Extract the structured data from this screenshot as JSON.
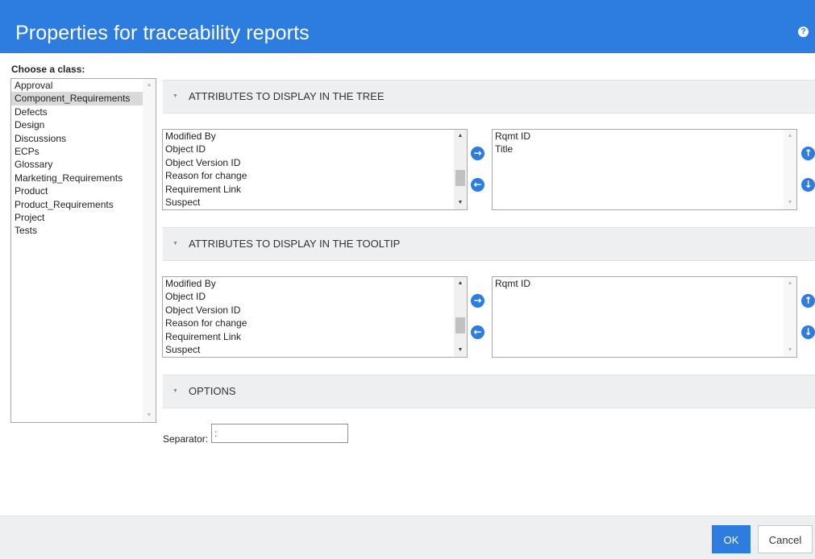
{
  "header": {
    "title": "Properties for traceability reports",
    "help_icon": "?"
  },
  "class_panel": {
    "label": "Choose a class:",
    "items": [
      {
        "label": "Approval",
        "selected": false
      },
      {
        "label": "Component_Requirements",
        "selected": true
      },
      {
        "label": "Defects",
        "selected": false
      },
      {
        "label": "Design",
        "selected": false
      },
      {
        "label": "Discussions",
        "selected": false
      },
      {
        "label": "ECPs",
        "selected": false
      },
      {
        "label": "Glossary",
        "selected": false
      },
      {
        "label": "Marketing_Requirements",
        "selected": false
      },
      {
        "label": "Product",
        "selected": false
      },
      {
        "label": "Product_Requirements",
        "selected": false
      },
      {
        "label": "Project",
        "selected": false
      },
      {
        "label": "Tests",
        "selected": false
      }
    ]
  },
  "tree_section": {
    "title": "ATTRIBUTES TO DISPLAY IN THE TREE",
    "available": [
      "Modified By",
      "Object ID",
      "Object Version ID",
      "Reason for change",
      "Requirement Link",
      "Suspect"
    ],
    "selected": [
      "Rqmt ID",
      "Title"
    ]
  },
  "tooltip_section": {
    "title": "ATTRIBUTES TO DISPLAY IN THE TOOLTIP",
    "available": [
      "Modified By",
      "Object ID",
      "Object Version ID",
      "Reason for change",
      "Requirement Link",
      "Suspect"
    ],
    "selected": [
      "Rqmt ID"
    ]
  },
  "options_section": {
    "title": "OPTIONS",
    "separator_label": "Separator:",
    "separator_value": ":"
  },
  "icons": {
    "caret": "▼",
    "scroll_up": "▲",
    "scroll_down": "▼",
    "move_right": "→",
    "move_left": "←",
    "move_up": "↑",
    "move_down": "↓"
  },
  "footer": {
    "ok_label": "OK",
    "cancel_label": "Cancel"
  },
  "colors": {
    "accent": "#2d7ce0",
    "section_bg": "#eeeff1",
    "selected_row": "#d9d9d9"
  }
}
